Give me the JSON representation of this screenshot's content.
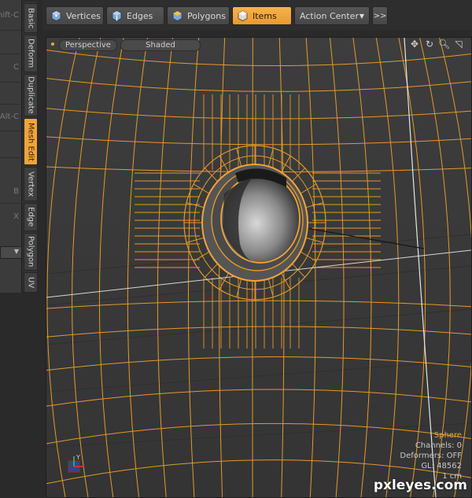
{
  "left_panel": {
    "shortcuts": [
      "hift-C",
      "C",
      "Alt-C",
      "B",
      "X"
    ]
  },
  "vertical_tabs": [
    {
      "label": "Basic",
      "active": false
    },
    {
      "label": "Deform",
      "active": false
    },
    {
      "label": "Duplicate",
      "active": false
    },
    {
      "label": "Mesh Edit",
      "active": true
    },
    {
      "label": "Vertex",
      "active": false
    },
    {
      "label": "Edge",
      "active": false
    },
    {
      "label": "Polygon",
      "active": false
    },
    {
      "label": "UV",
      "active": false
    }
  ],
  "toolbar": {
    "vertices_label": "Vertices",
    "edges_label": "Edges",
    "polygons_label": "Polygons",
    "items_label": "Items",
    "action_center_label": "Action Center",
    "more_label": ">>"
  },
  "viewport": {
    "view_label": "Perspective",
    "shading_label": "Shaded",
    "info": {
      "item_name": "Sphere",
      "channels": "Channels: 0",
      "deformers": "Deformers: OFF",
      "gl": "GL: 48562",
      "unit": "1 cm"
    },
    "axis_label": "Y"
  },
  "colors": {
    "accent": "#f0a43a",
    "wireframe": "#e39a2a",
    "surface": "#3c3c3c"
  },
  "icons": [
    "move-icon",
    "rotate-icon",
    "zoom-icon",
    "fit-icon"
  ],
  "watermark": "pxleyes.com"
}
